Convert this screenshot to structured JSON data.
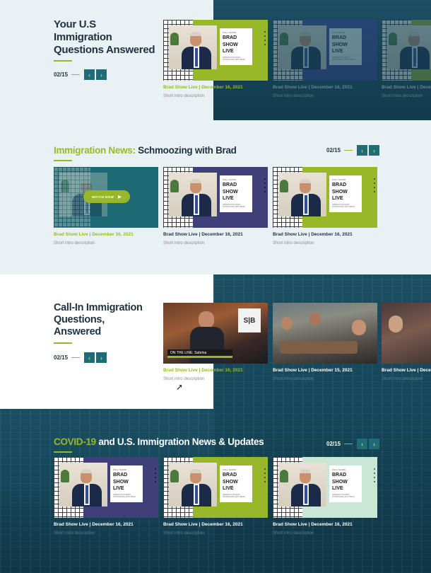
{
  "colors": {
    "accent": "#98b82a",
    "dark": "#1f3140",
    "teal": "#1f6b78",
    "purple": "#3f3f7a",
    "mint": "#c9e8d4"
  },
  "section1": {
    "title_line1": "Your U.S",
    "title_line2": "Immigration",
    "title_line3": "Questions Answered",
    "pager": "02/15"
  },
  "section2": {
    "title_accent": "Immigration News:",
    "title_rest": " Schmoozing with Brad",
    "pager": "02/15"
  },
  "section3": {
    "title_line1": "Call-In Immigration",
    "title_line2": "Questions,",
    "title_line3": "Answered",
    "pager": "02/15"
  },
  "section4": {
    "title_accent": "COVID-19",
    "title_rest": " and U.S. Immigration News & Updates",
    "pager": "02/15"
  },
  "thumb": {
    "small": "FULL SHOW",
    "big1": "BRAD",
    "big2": "SHOW",
    "big3": "LIVE",
    "sub": "IMMIGRATION NEWS SCHMOOZING WITH BRAD"
  },
  "watch_label": "WATCH NOW",
  "on_the_line": "ON THE LINE: Sabrina",
  "cards": {
    "meta_dec16": "Brad Show Live | December 16, 2021",
    "meta_dec15": "Brad Show Live | December 15, 2021",
    "desc": "Short intro description"
  },
  "icons": {
    "prev": "chevron-left-icon",
    "next": "chevron-right-icon",
    "play": "play-icon",
    "cursor": "mouse-cursor-icon"
  }
}
